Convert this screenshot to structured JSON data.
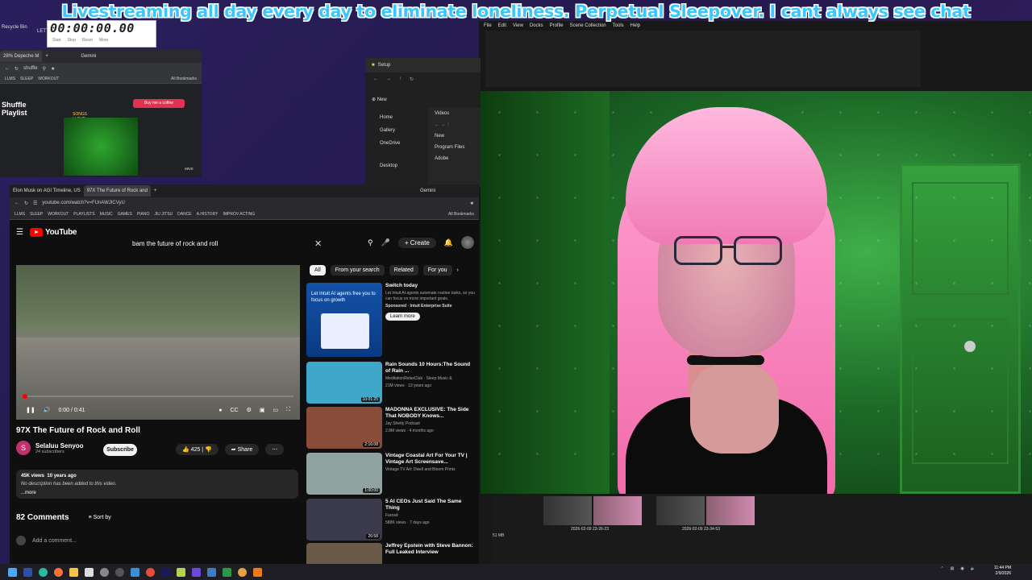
{
  "banner": {
    "text": "Livestreaming all day every day to eliminate loneliness. Perpetual Sleepover. I cant always see chat"
  },
  "desktop": {
    "recycle_bin": "Recycle Bin",
    "second_icon": "LETTE"
  },
  "timer": {
    "time": "00:00:00.00",
    "btn_start": "Start",
    "btn_stop": "Stop",
    "btn_reset": "Reset",
    "btn_more": "More"
  },
  "small_browser": {
    "tab_title": "28% Depeche M",
    "gemini": "Gemini",
    "address": "shuffle",
    "bookmarks": [
      "LLMS",
      "SLEEP",
      "WORKOUT"
    ],
    "all_bookmarks": "All Bookmarks",
    "page_title": "Shuffle Playlist",
    "buy_button": "Buy me a coffee",
    "songs_label": "SONGS I LOVE 2/4/2253",
    "vevo": "vevo"
  },
  "explorer": {
    "title": "Setup",
    "new_button": "New",
    "items": [
      "Home",
      "Gallery",
      "OneDrive",
      "Desktop"
    ],
    "sub_items": [
      "Videos",
      "New",
      "Program Files",
      "Adobe"
    ]
  },
  "obs": {
    "menu": [
      "File",
      "Edit",
      "View",
      "Docks",
      "Profile",
      "Scene Collection",
      "Tools",
      "Help"
    ],
    "size_label": "51 MB"
  },
  "main_browser": {
    "tabs": [
      "Elon Musk on AGI Timeline, US",
      "97X The Future of Rock and"
    ],
    "gemini": "Gemini",
    "address": "youtube.com/watch?v=FUnAWJICVyU",
    "bookmarks": [
      "LLMS",
      "SLEEP",
      "WORKOUT",
      "PLAYLISTS",
      "MUSIC",
      "GAMES",
      "PIANO",
      "JIU JITSU",
      "DANCE",
      "A.HISTORY",
      "IMPROV ACTING"
    ],
    "all_bookmarks": "All Bookmarks"
  },
  "youtube": {
    "logo": "YouTube",
    "search_query": "bam the future of rock and roll",
    "create": "Create",
    "player": {
      "time": "0:00 / 0:41"
    },
    "video_title": "97X The Future of Rock and Roll",
    "channel_name": "Selaluu Senyoo",
    "channel_subs": "24 subscribers",
    "subscribe": "Subscribe",
    "likes": "425",
    "share": "Share",
    "views": "45K views",
    "age": "10 years ago",
    "desc_info": "No description has been added to this video.",
    "more": "...more",
    "comments_count": "82 Comments",
    "sort_by": "Sort by",
    "add_comment": "Add a comment...",
    "chips": [
      "All",
      "From your search",
      "Related",
      "For you"
    ],
    "ad": {
      "thumb_text": "Let Intuit AI agents free you to focus on growth",
      "title": "Switch today",
      "body": "Let Intuit AI agents automate routine tasks, so you can focus on more important goals.",
      "sponsor": "Sponsored · Intuit Enterprise Suite",
      "learn": "Learn more"
    },
    "recommendations": [
      {
        "title": "Rain Sounds 10 Hours:The Sound of Rain ...",
        "channel": "MeditationRelaxClub · Sleep Music &",
        "meta": "21M views · 13 years ago",
        "duration": "10:01:25",
        "color": "#3fa7c9"
      },
      {
        "title": "MADONNA EXCLUSIVE: The Side That NOBODY Knows...",
        "channel": "Jay Shetty Podcast",
        "meta": "2.8M views · 4 months ago",
        "duration": "2:16:08",
        "color": "#8a4d3a"
      },
      {
        "title": "Vintage Coastal Art For Your TV | Vintage Art Screensave...",
        "channel": "Vintage TV Art: Dwell and Bloom Prints",
        "meta": "",
        "duration": "1:00:00",
        "color": "#8fa3a0"
      },
      {
        "title": "5 AI CEOs Just Said The Same Thing",
        "channel": "Farzad",
        "meta": "588K views · 7 days ago",
        "duration": "26:58",
        "color": "#3a3a4a"
      },
      {
        "title": "Jeffrey Epstein with Steve Bannon: Full Leaked Interview",
        "channel": "",
        "meta": "",
        "duration": "",
        "color": "#6a5a4a"
      }
    ]
  },
  "scenes": [
    {
      "label": "2026-02-09 23-26-23"
    },
    {
      "label": "2026-02-09 23-34-53"
    }
  ],
  "taskbar": {
    "time": "11:44 PM",
    "date": "2/9/2026"
  }
}
